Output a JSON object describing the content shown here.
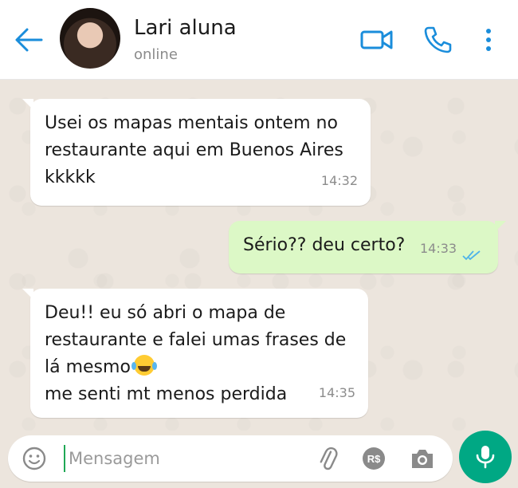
{
  "header": {
    "contact_name": "Lari aluna",
    "status": "online",
    "accent_color": "#1a8ddb"
  },
  "messages": [
    {
      "direction": "incoming",
      "lines": [
        "Usei os mapas mentais ontem no",
        "restaurante aqui em Buenos Aires",
        "kkkkk"
      ],
      "time": "14:32"
    },
    {
      "direction": "outgoing",
      "lines": [
        "Sério?? deu certo?"
      ],
      "time": "14:33",
      "status_icon": "double-check-read-icon"
    },
    {
      "direction": "incoming",
      "lines": [
        "Deu!! eu só abri o mapa de",
        "restaurante e falei umas frases de",
        "lá mesmo",
        "me senti mt menos perdida"
      ],
      "emoji": "face-with-tears-of-joy-icon",
      "time": "14:35"
    }
  ],
  "composer": {
    "placeholder": "Mensagem",
    "pay_label": "R$"
  },
  "colors": {
    "chat_background": "#ece5dd",
    "incoming_bubble": "#ffffff",
    "outgoing_bubble": "#dcf8c6",
    "mic_button": "#00a884"
  }
}
